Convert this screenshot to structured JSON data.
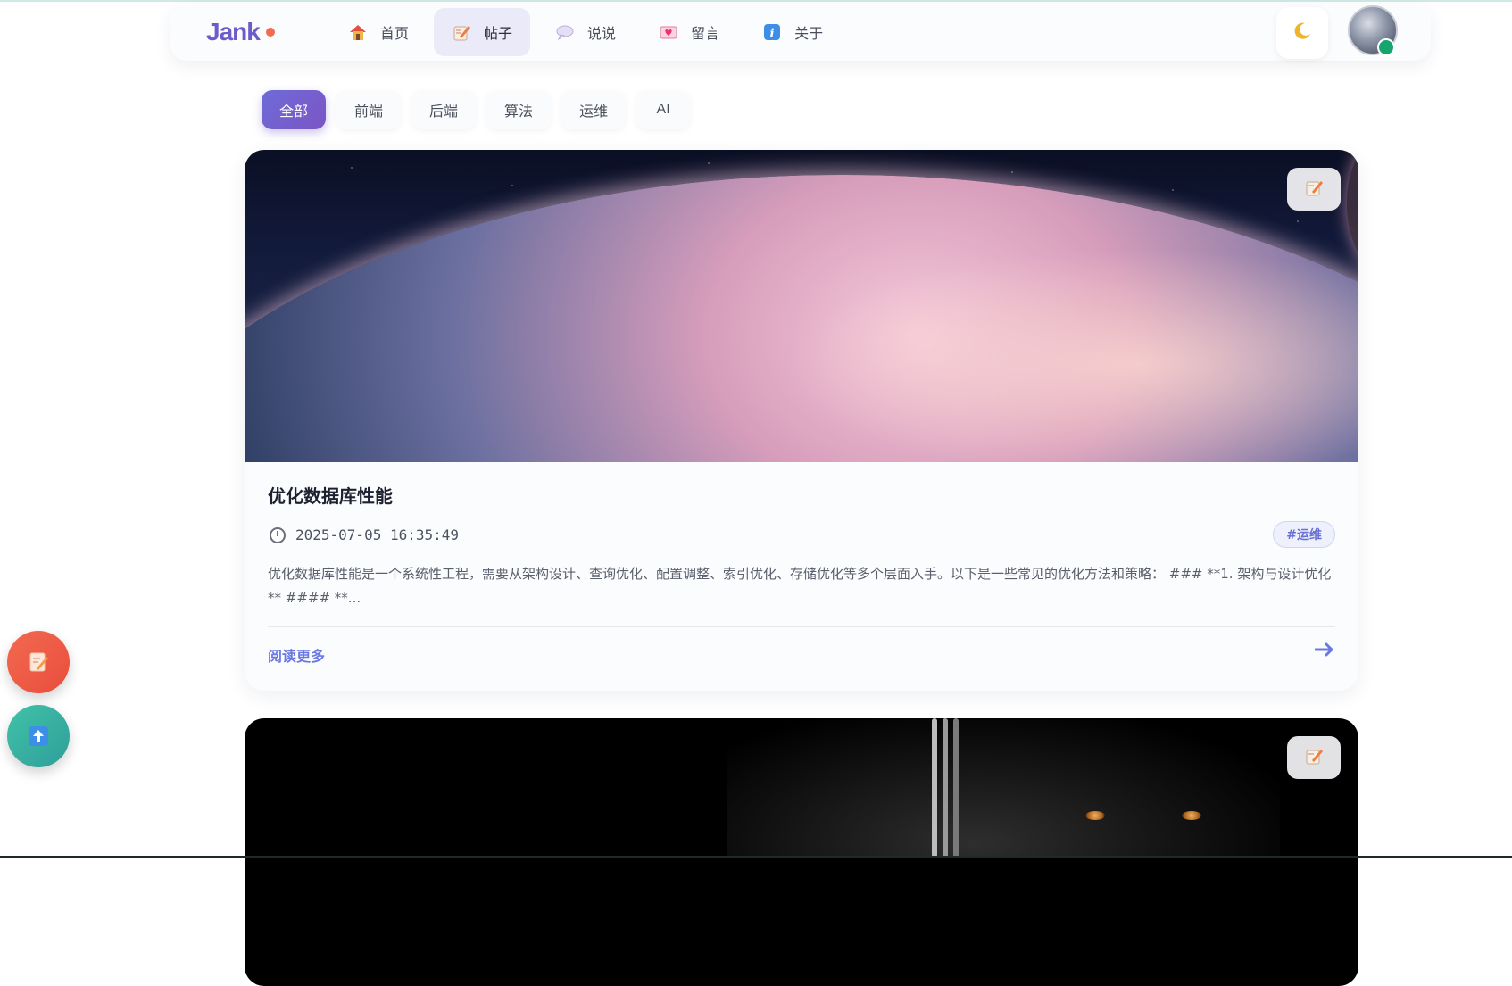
{
  "header": {
    "logo": "Jank",
    "nav": [
      {
        "label": "首页",
        "icon": "house-icon"
      },
      {
        "label": "帖子",
        "icon": "memo-icon",
        "active": true
      },
      {
        "label": "说说",
        "icon": "speech-bubble-icon"
      },
      {
        "label": "留言",
        "icon": "heart-letter-icon"
      },
      {
        "label": "关于",
        "icon": "info-icon"
      }
    ],
    "theme_toggle_icon": "moon-icon",
    "avatar_status": "online"
  },
  "filters": {
    "items": [
      "全部",
      "前端",
      "后端",
      "算法",
      "运维",
      "AI"
    ],
    "active": "全部"
  },
  "posts": [
    {
      "title": "优化数据库性能",
      "date": "2025-07-05 16:35:49",
      "tag": "#运维",
      "excerpt": "优化数据库性能是一个系统性工程，需要从架构设计、查询优化、配置调整、索引优化、存储优化等多个层面入手。以下是一些常见的优化方法和策略： ### **1. 架构与设计优化** #### **...",
      "read_more": "阅读更多",
      "cover": "planet-horizon-image"
    },
    {
      "cover": "dark-portrait-image"
    }
  ],
  "floating": {
    "write_icon": "memo-icon",
    "top_icon": "up-arrow-icon"
  },
  "colors": {
    "accent": "#6e6bd8",
    "logo": "#6c5bc9",
    "write_button": "#f26a50",
    "top_button": "#41c2a8",
    "online": "#16a56f"
  }
}
